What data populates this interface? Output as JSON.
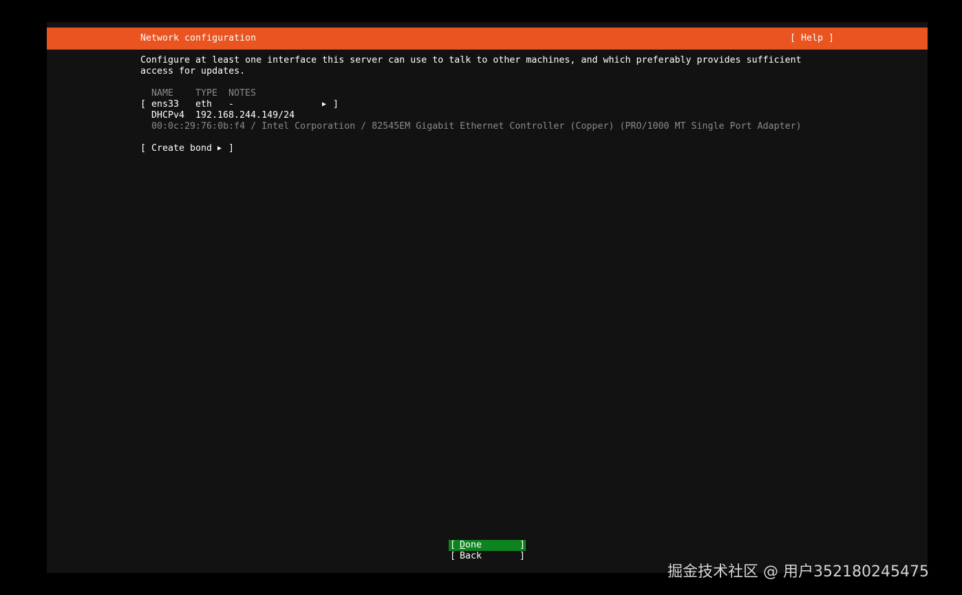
{
  "header": {
    "title": "Network configuration",
    "help_label": "[ Help ]"
  },
  "intro": {
    "line1": "Configure at least one interface this server can use to talk to other machines, and which preferably provides sufficient",
    "line2": "access for updates."
  },
  "table": {
    "columns": [
      "NAME",
      "TYPE",
      "NOTES"
    ],
    "rows": [
      {
        "open_bracket": "[",
        "name": "ens33",
        "type": "eth",
        "notes": "-",
        "close_bracket": "]",
        "addr_method": "DHCPv4",
        "address": "192.168.244.149/24",
        "hw_info": "00:0c:29:76:0b:f4 / Intel Corporation / 82545EM Gigabit Ethernet Controller (Copper) (PRO/1000 MT Single Port Adapter)"
      }
    ]
  },
  "create_bond": {
    "open_bracket": "[",
    "label": "Create bond",
    "close_bracket": "]"
  },
  "buttons": {
    "done": {
      "open": "[",
      "underline_char": "D",
      "rest": "one",
      "close": "]"
    },
    "back": {
      "open": "[",
      "label": "Back",
      "close": "]"
    }
  },
  "watermark": "掘金技术社区 @ 用户352180245475",
  "colors": {
    "header_bg": "#e95420",
    "screen_bg": "#121212",
    "focus_bg": "#0e8420",
    "dim_text": "#8a8a8a"
  },
  "icons": [
    "submenu-arrow-icon"
  ]
}
